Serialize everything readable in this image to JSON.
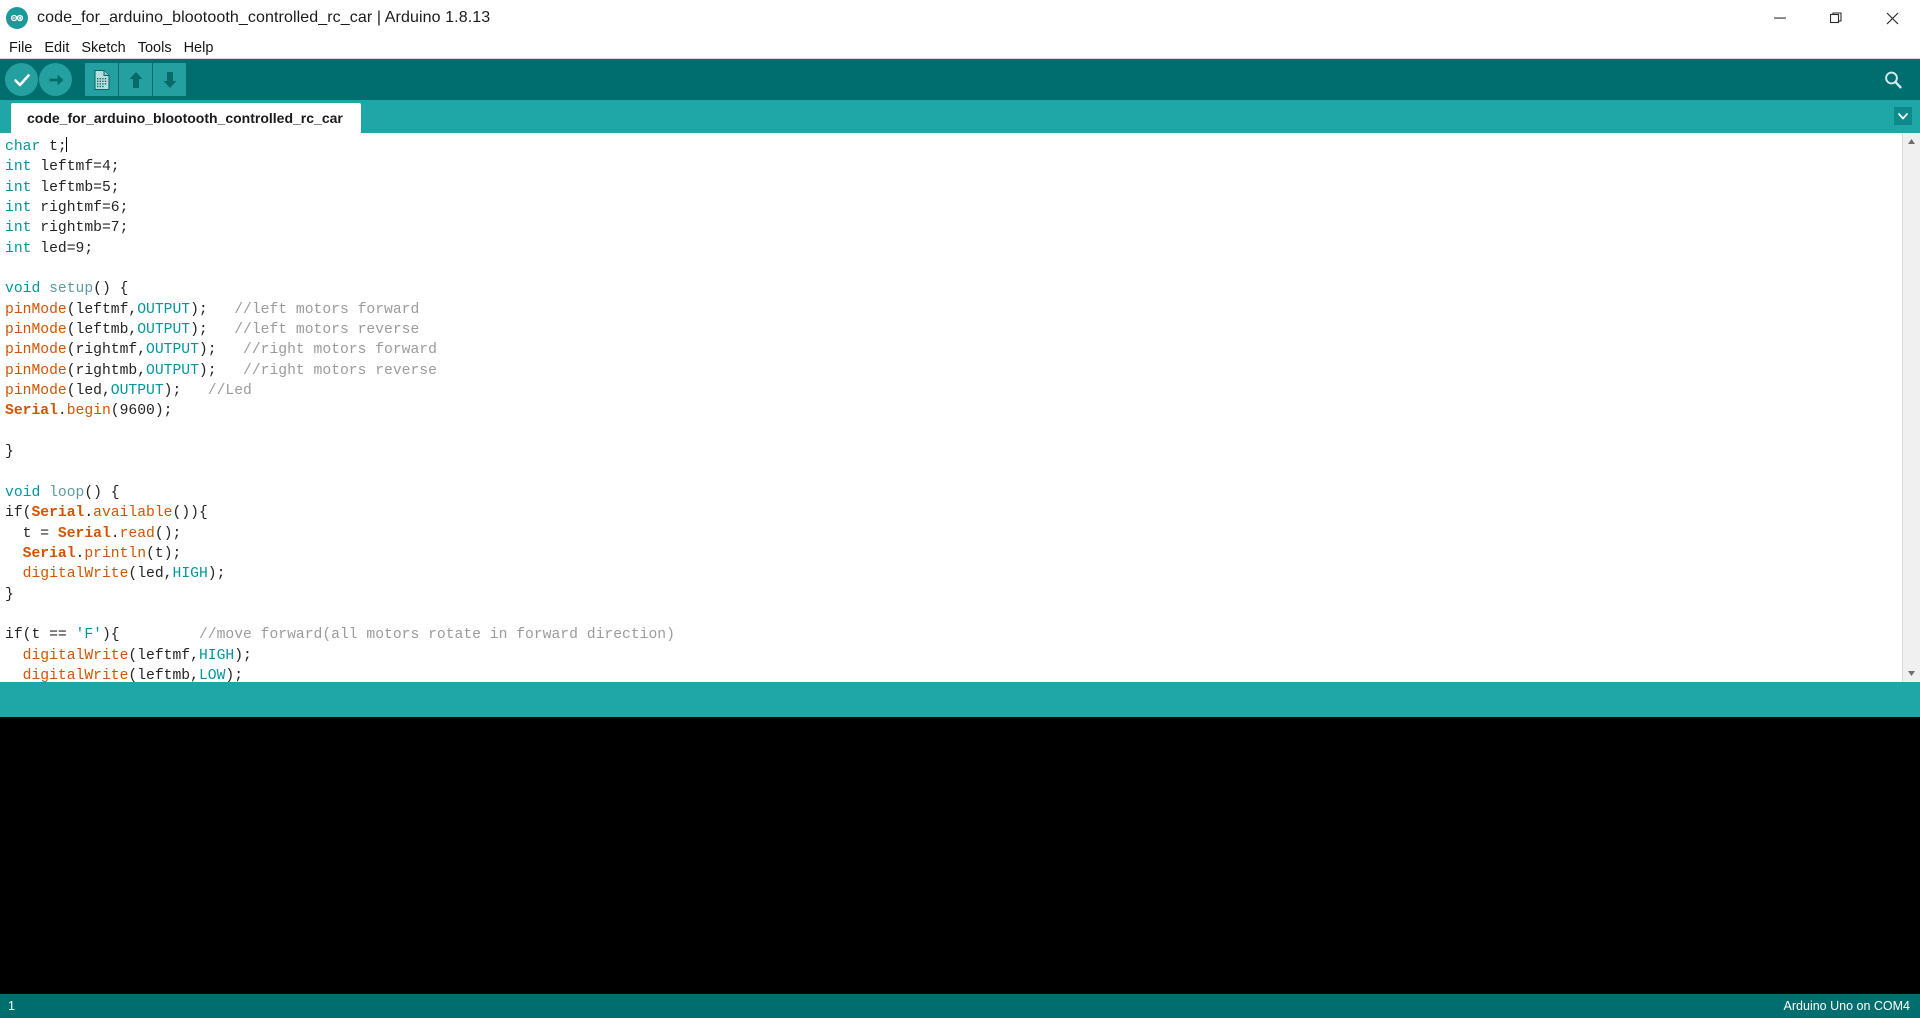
{
  "window": {
    "title": "code_for_arduino_blootooth_controlled_rc_car | Arduino 1.8.13",
    "logo_icon": "arduino-infinity-logo",
    "controls": [
      {
        "name": "minimize",
        "icon": "minimize-icon"
      },
      {
        "name": "maximize",
        "icon": "maximize-restore-icon"
      },
      {
        "name": "close",
        "icon": "close-icon"
      }
    ]
  },
  "menubar": {
    "items": [
      {
        "label": "File"
      },
      {
        "label": "Edit"
      },
      {
        "label": "Sketch"
      },
      {
        "label": "Tools"
      },
      {
        "label": "Help"
      }
    ]
  },
  "toolbar": {
    "buttons": [
      {
        "name": "verify-compile-button",
        "icon": "check-icon",
        "tooltip": "Verify"
      },
      {
        "name": "upload-button",
        "icon": "arrow-right-icon",
        "tooltip": "Upload"
      },
      {
        "name": "new-sketch-button",
        "icon": "new-file-icon",
        "tooltip": "New"
      },
      {
        "name": "open-sketch-button",
        "icon": "arrow-up-icon",
        "tooltip": "Open"
      },
      {
        "name": "save-sketch-button",
        "icon": "arrow-down-icon",
        "tooltip": "Save"
      }
    ],
    "serial_monitor": {
      "name": "serial-monitor-button",
      "icon": "magnifier-icon",
      "tooltip": "Serial Monitor"
    }
  },
  "tabs": {
    "active": "code_for_arduino_blootooth_controlled_rc_car",
    "items": [
      {
        "label": "code_for_arduino_blootooth_controlled_rc_car"
      }
    ],
    "menu_icon": "chevron-down-icon"
  },
  "editor": {
    "colors": {
      "keyword": "#00979C",
      "function": "#D35400",
      "constant": "#00979C",
      "string": "#00979C",
      "comment": "#9B9B9B",
      "plain": "#242424",
      "background": "#FFFFFF"
    },
    "cursor_line": 1,
    "lines": [
      [
        {
          "t": "char",
          "c": "kw"
        },
        {
          "t": " t;",
          "c": "plain"
        },
        {
          "t": "",
          "c": "caret"
        }
      ],
      [
        {
          "t": "int",
          "c": "kw"
        },
        {
          "t": " leftmf=4;",
          "c": "plain"
        }
      ],
      [
        {
          "t": "int",
          "c": "kw"
        },
        {
          "t": " leftmb=5;",
          "c": "plain"
        }
      ],
      [
        {
          "t": "int",
          "c": "kw"
        },
        {
          "t": " rightmf=6;",
          "c": "plain"
        }
      ],
      [
        {
          "t": "int",
          "c": "kw"
        },
        {
          "t": " rightmb=7;",
          "c": "plain"
        }
      ],
      [
        {
          "t": "int",
          "c": "kw"
        },
        {
          "t": " led=9;",
          "c": "plain"
        }
      ],
      [],
      [
        {
          "t": "void",
          "c": "kw"
        },
        {
          "t": " ",
          "c": "plain"
        },
        {
          "t": "setup",
          "c": "fn"
        },
        {
          "t": "() {",
          "c": "plain"
        }
      ],
      [
        {
          "t": "pinMode",
          "c": "func"
        },
        {
          "t": "(leftmf,",
          "c": "plain"
        },
        {
          "t": "OUTPUT",
          "c": "const"
        },
        {
          "t": ");   ",
          "c": "plain"
        },
        {
          "t": "//left motors forward",
          "c": "com"
        }
      ],
      [
        {
          "t": "pinMode",
          "c": "func"
        },
        {
          "t": "(leftmb,",
          "c": "plain"
        },
        {
          "t": "OUTPUT",
          "c": "const"
        },
        {
          "t": ");   ",
          "c": "plain"
        },
        {
          "t": "//left motors reverse",
          "c": "com"
        }
      ],
      [
        {
          "t": "pinMode",
          "c": "func"
        },
        {
          "t": "(rightmf,",
          "c": "plain"
        },
        {
          "t": "OUTPUT",
          "c": "const"
        },
        {
          "t": ");   ",
          "c": "plain"
        },
        {
          "t": "//right motors forward",
          "c": "com"
        }
      ],
      [
        {
          "t": "pinMode",
          "c": "func"
        },
        {
          "t": "(rightmb,",
          "c": "plain"
        },
        {
          "t": "OUTPUT",
          "c": "const"
        },
        {
          "t": ");   ",
          "c": "plain"
        },
        {
          "t": "//right motors reverse",
          "c": "com"
        }
      ],
      [
        {
          "t": "pinMode",
          "c": "func"
        },
        {
          "t": "(led,",
          "c": "plain"
        },
        {
          "t": "OUTPUT",
          "c": "const"
        },
        {
          "t": ");   ",
          "c": "plain"
        },
        {
          "t": "//Led",
          "c": "com"
        }
      ],
      [
        {
          "t": "Serial",
          "c": "obj"
        },
        {
          "t": ".",
          "c": "plain"
        },
        {
          "t": "begin",
          "c": "func"
        },
        {
          "t": "(9600);",
          "c": "plain"
        }
      ],
      [],
      [
        {
          "t": "}",
          "c": "plain"
        }
      ],
      [],
      [
        {
          "t": "void",
          "c": "kw"
        },
        {
          "t": " ",
          "c": "plain"
        },
        {
          "t": "loop",
          "c": "fn"
        },
        {
          "t": "() {",
          "c": "plain"
        }
      ],
      [
        {
          "t": "if(",
          "c": "plain"
        },
        {
          "t": "Serial",
          "c": "obj"
        },
        {
          "t": ".",
          "c": "plain"
        },
        {
          "t": "available",
          "c": "func"
        },
        {
          "t": "()){",
          "c": "plain"
        }
      ],
      [
        {
          "t": "  t = ",
          "c": "plain"
        },
        {
          "t": "Serial",
          "c": "obj"
        },
        {
          "t": ".",
          "c": "plain"
        },
        {
          "t": "read",
          "c": "func"
        },
        {
          "t": "();",
          "c": "plain"
        }
      ],
      [
        {
          "t": "  ",
          "c": "plain"
        },
        {
          "t": "Serial",
          "c": "obj"
        },
        {
          "t": ".",
          "c": "plain"
        },
        {
          "t": "println",
          "c": "func"
        },
        {
          "t": "(t);",
          "c": "plain"
        }
      ],
      [
        {
          "t": "  ",
          "c": "plain"
        },
        {
          "t": "digitalWrite",
          "c": "func"
        },
        {
          "t": "(led,",
          "c": "plain"
        },
        {
          "t": "HIGH",
          "c": "const"
        },
        {
          "t": ");",
          "c": "plain"
        }
      ],
      [
        {
          "t": "}",
          "c": "plain"
        }
      ],
      [],
      [
        {
          "t": "if(t == ",
          "c": "plain"
        },
        {
          "t": "'F'",
          "c": "str"
        },
        {
          "t": "){         ",
          "c": "plain"
        },
        {
          "t": "//move forward(all motors rotate in forward direction)",
          "c": "com"
        }
      ],
      [
        {
          "t": "  ",
          "c": "plain"
        },
        {
          "t": "digitalWrite",
          "c": "func"
        },
        {
          "t": "(leftmf,",
          "c": "plain"
        },
        {
          "t": "HIGH",
          "c": "const"
        },
        {
          "t": ");",
          "c": "plain"
        }
      ],
      [
        {
          "t": "  ",
          "c": "plain"
        },
        {
          "t": "digitalWrite",
          "c": "func"
        },
        {
          "t": "(leftmb,",
          "c": "plain"
        },
        {
          "t": "LOW",
          "c": "const"
        },
        {
          "t": ");",
          "c": "plain"
        }
      ]
    ],
    "scrollbar": {
      "up_arrow_icon": "scroll-up-arrow-icon",
      "down_arrow_icon": "scroll-down-arrow-icon"
    }
  },
  "console": {
    "text": ""
  },
  "statusbar": {
    "line_number": "1",
    "board_info": "Arduino Uno on COM4"
  }
}
